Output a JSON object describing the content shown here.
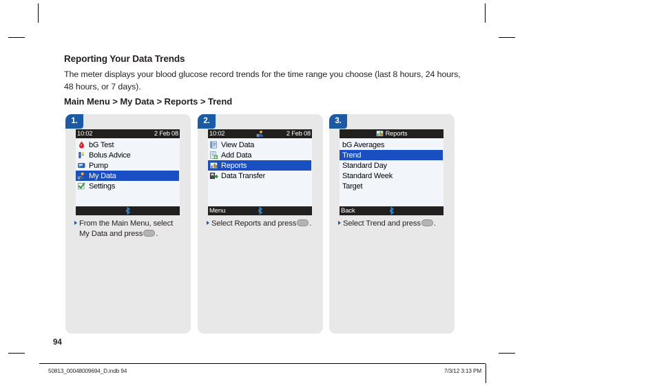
{
  "document": {
    "section_title": "Reporting Your Data Trends",
    "intro_paragraph": "The meter displays your blood glucose record trends for the time range you choose (last 8 hours, 24 hours, 48 hours, or 7 days).",
    "breadcrumb": "Main Menu > My Data > Reports > Trend",
    "page_number": "94"
  },
  "footer": {
    "file_name": "50813_00048009694_D.indb   94",
    "timestamp": "7/3/12   3:13 PM"
  },
  "colors": {
    "badge_blue": "#1b5ba6",
    "selection_blue": "#1a4fc4",
    "panel_gray": "#e8e8e8",
    "screen_bg": "#f2f6fb",
    "bar_black": "#221f1f",
    "bluetooth_blue": "#1f7fd4",
    "accent_red": "#e0202a",
    "accent_green": "#2f9e2f"
  },
  "steps": [
    {
      "badge": "1.",
      "screen": {
        "titlebar": {
          "left": "10:02",
          "right": "2 Feb 08",
          "center": "",
          "center_icon": ""
        },
        "menu_items": [
          {
            "label": "bG Test",
            "icon": "blood-drop-icon",
            "selected": false
          },
          {
            "label": "Bolus Advice",
            "icon": "bolus-syringe-icon",
            "selected": false
          },
          {
            "label": "Pump",
            "icon": "pump-icon",
            "selected": false
          },
          {
            "label": "My Data",
            "icon": "my-data-person-icon",
            "selected": true
          },
          {
            "label": "Settings",
            "icon": "settings-check-icon",
            "selected": false
          }
        ],
        "statusbar": {
          "label": "",
          "bluetooth_icon": "bluetooth-icon"
        }
      },
      "caption_line1": "From the Main Menu, select",
      "caption_line2_before": "My Data and press",
      "caption_line2_after": ".",
      "caption_button_icon": "ok-button-icon"
    },
    {
      "badge": "2.",
      "screen": {
        "titlebar": {
          "left": "10:02",
          "right": "2 Feb 08",
          "center": "",
          "center_icon": "my-data-person-icon"
        },
        "menu_items": [
          {
            "label": "View Data",
            "icon": "view-data-icon",
            "selected": false
          },
          {
            "label": "Add Data",
            "icon": "add-data-icon",
            "selected": false
          },
          {
            "label": "Reports",
            "icon": "reports-chart-icon",
            "selected": true
          },
          {
            "label": "Data Transfer",
            "icon": "data-transfer-icon",
            "selected": false
          }
        ],
        "statusbar": {
          "label": "Menu",
          "bluetooth_icon": "bluetooth-icon"
        }
      },
      "caption_line1": "Select Reports and press",
      "caption_line2_before": "",
      "caption_line2_after": ".",
      "caption_button_icon": "ok-button-icon"
    },
    {
      "badge": "3.",
      "screen": {
        "titlebar": {
          "left": "",
          "right": "",
          "center": "Reports",
          "center_icon": "reports-chart-icon"
        },
        "menu_items": [
          {
            "label": "bG Averages",
            "icon": "",
            "selected": false
          },
          {
            "label": "Trend",
            "icon": "",
            "selected": true
          },
          {
            "label": "Standard Day",
            "icon": "",
            "selected": false
          },
          {
            "label": "Standard Week",
            "icon": "",
            "selected": false
          },
          {
            "label": "Target",
            "icon": "",
            "selected": false
          }
        ],
        "statusbar": {
          "label": "Back",
          "bluetooth_icon": "bluetooth-icon"
        }
      },
      "caption_line1": "Select Trend and press",
      "caption_line2_before": "",
      "caption_line2_after": ".",
      "caption_button_icon": "ok-button-icon"
    }
  ]
}
